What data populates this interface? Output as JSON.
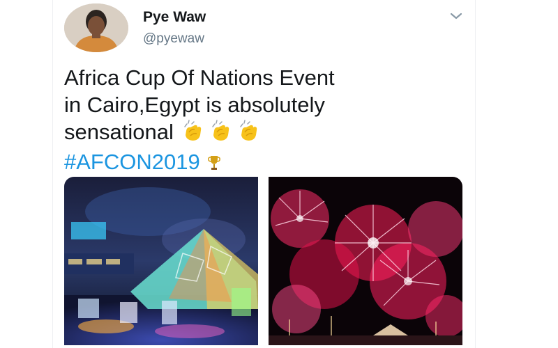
{
  "tweet": {
    "author_name": "Pye Waw",
    "author_handle": "@pyewaw",
    "text_lines": [
      "Africa Cup Of Nations Event",
      "in Cairo,Egypt is absolutely",
      "sensational"
    ],
    "hashtag": "#AFCON2019",
    "emojis": [
      "clapping-hands",
      "clapping-hands",
      "clapping-hands",
      "trophy"
    ],
    "colors": {
      "name": "#14171a",
      "handle": "#657786",
      "hashtag": "#1b95e0",
      "background": "#ffffff"
    }
  },
  "media": [
    {
      "description_icon": "pyramid-stage-photo"
    },
    {
      "description_icon": "fireworks-photo"
    }
  ]
}
